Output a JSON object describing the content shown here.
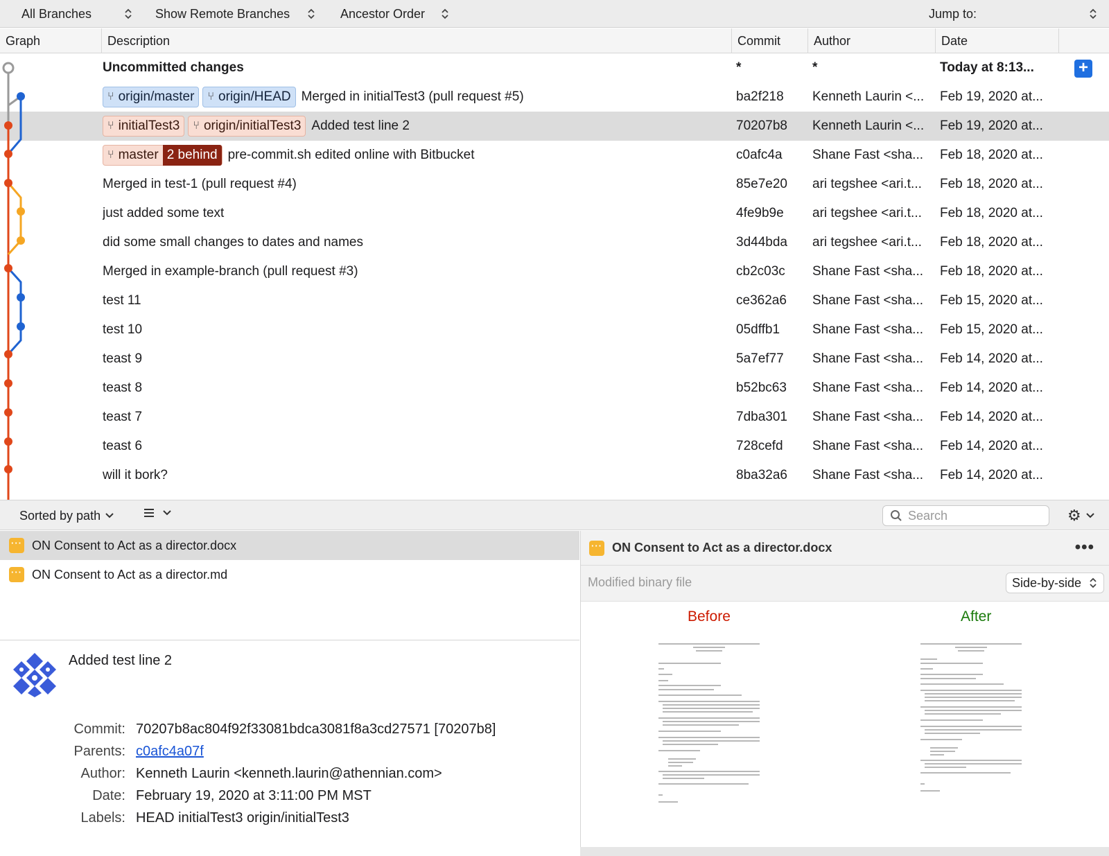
{
  "toolbar": {
    "branches": "All Branches",
    "remote": "Show Remote Branches",
    "order": "Ancestor Order",
    "jump": "Jump to:"
  },
  "columns": {
    "graph": "Graph",
    "description": "Description",
    "commit": "Commit",
    "author": "Author",
    "date": "Date"
  },
  "commits": [
    {
      "desc": "Uncommitted changes",
      "commit": "*",
      "author": "*",
      "date": "Today at 8:13..."
    },
    {
      "desc": "Merged in initialTest3 (pull request #5)",
      "commit": "ba2f218",
      "author": "Kenneth Laurin <...",
      "date": "Feb 19, 2020 at..."
    },
    {
      "desc": "Added test line 2",
      "commit": "70207b8",
      "author": "Kenneth Laurin <...",
      "date": "Feb 19, 2020 at..."
    },
    {
      "desc": "pre-commit.sh edited online with Bitbucket",
      "commit": "c0afc4a",
      "author": "Shane Fast <sha...",
      "date": "Feb 18, 2020 at..."
    },
    {
      "desc": "Merged in test-1 (pull request #4)",
      "commit": "85e7e20",
      "author": "ari tegshee <ari.t...",
      "date": "Feb 18, 2020 at..."
    },
    {
      "desc": "just added some text",
      "commit": "4fe9b9e",
      "author": "ari tegshee <ari.t...",
      "date": "Feb 18, 2020 at..."
    },
    {
      "desc": "did some small changes to dates and names",
      "commit": "3d44bda",
      "author": "ari tegshee <ari.t...",
      "date": "Feb 18, 2020 at..."
    },
    {
      "desc": "Merged in example-branch (pull request #3)",
      "commit": "cb2c03c",
      "author": "Shane Fast <sha...",
      "date": "Feb 18, 2020 at..."
    },
    {
      "desc": "test 11",
      "commit": "ce362a6",
      "author": "Shane Fast <sha...",
      "date": "Feb 15, 2020 at..."
    },
    {
      "desc": "test 10",
      "commit": "05dffb1",
      "author": "Shane Fast <sha...",
      "date": "Feb 15, 2020 at..."
    },
    {
      "desc": "teast 9",
      "commit": "5a7ef77",
      "author": "Shane Fast <sha...",
      "date": "Feb 14, 2020 at..."
    },
    {
      "desc": "teast 8",
      "commit": "b52bc63",
      "author": "Shane Fast <sha...",
      "date": "Feb 14, 2020 at..."
    },
    {
      "desc": "teast 7",
      "commit": "7dba301",
      "author": "Shane Fast <sha...",
      "date": "Feb 14, 2020 at..."
    },
    {
      "desc": "teast 6",
      "commit": "728cefd",
      "author": "Shane Fast <sha...",
      "date": "Feb 14, 2020 at..."
    },
    {
      "desc": "will it bork?",
      "commit": "8ba32a6",
      "author": "Shane Fast <sha...",
      "date": "Feb 14, 2020 at..."
    }
  ],
  "labels": {
    "origin_master": "origin/master",
    "origin_head": "origin/HEAD",
    "initialTest3": "initialTest3",
    "origin_initialTest3": "origin/initialTest3",
    "master": "master",
    "behind": "2 behind"
  },
  "midbar": {
    "sorted": "Sorted by path",
    "search_placeholder": "Search"
  },
  "files": [
    {
      "name": "ON Consent to Act as a director.docx"
    },
    {
      "name": "ON Consent to Act as a director.md"
    }
  ],
  "details": {
    "subject": "Added test line 2",
    "commit_label": "Commit:",
    "commit_value": "70207b8ac804f92f33081bdca3081f8a3cd27571 [70207b8]",
    "parents_label": "Parents:",
    "parents_value": "c0afc4a07f",
    "author_label": "Author:",
    "author_value": "Kenneth Laurin <kenneth.laurin@athennian.com>",
    "date_label": "Date:",
    "date_value": "February 19, 2020 at 3:11:00 PM MST",
    "labels_label": "Labels:",
    "labels_value": "HEAD initialTest3 origin/initialTest3"
  },
  "diff": {
    "file": "ON Consent to Act as a director.docx",
    "status": "Modified binary file",
    "view_mode": "Side-by-side",
    "before": "Before",
    "after": "After"
  },
  "colors": {
    "red_branch": "#e0471a",
    "blue_branch": "#1f63d1",
    "orange_branch": "#f5a623",
    "gray_branch": "#9a9a9a",
    "selection": "#dcdcdc",
    "accent": "#1f6fe0"
  }
}
